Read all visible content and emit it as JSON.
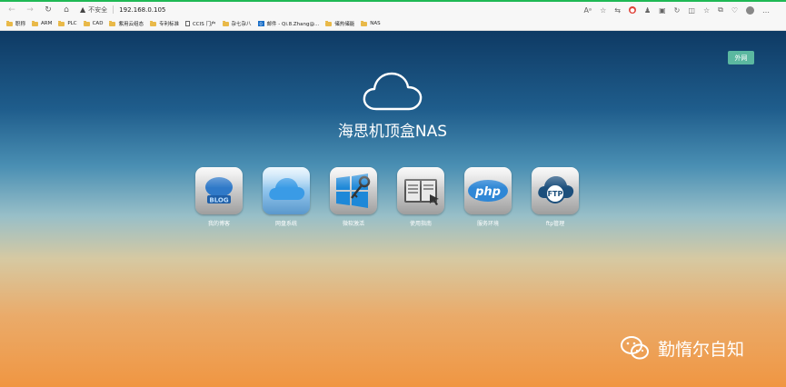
{
  "browser": {
    "security_label": "不安全",
    "url": "192.168.0.105",
    "bookmarks": [
      "职称",
      "ARM",
      "PLC",
      "CAD",
      "紫用云组态",
      "专利标准",
      "CCIS 门户",
      "杂七杂八",
      "邮件 - Qi.8.Zhang@...",
      "储热储能",
      "NAS"
    ]
  },
  "page": {
    "external_button": "外网",
    "title": "海思机顶盒NAS",
    "apps": [
      {
        "label": "我的博客",
        "icon": "blog-icon"
      },
      {
        "label": "网盘系统",
        "icon": "cloud-drive-icon"
      },
      {
        "label": "微软激活",
        "icon": "windows-key-icon"
      },
      {
        "label": "使用指南",
        "icon": "guide-book-icon"
      },
      {
        "label": "服务环境",
        "icon": "php-icon"
      },
      {
        "label": "ftp管理",
        "icon": "ftp-icon"
      }
    ]
  },
  "watermark": {
    "text": "勤惰尔自知"
  },
  "colors": {
    "accent_green": "#5bb8a0",
    "top_progress": "#1fb955"
  }
}
